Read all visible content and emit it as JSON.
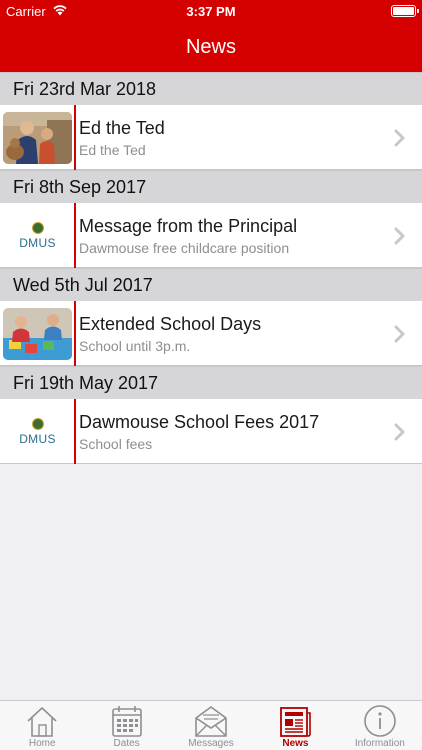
{
  "status_bar": {
    "carrier": "Carrier",
    "time": "3:37 PM"
  },
  "nav": {
    "title": "News"
  },
  "sections": [
    {
      "date": "Fri 23rd Mar 2018",
      "item": {
        "title": "Ed the Ted",
        "subtitle": "Ed the Ted",
        "thumbnail": "photo-children-teddy"
      }
    },
    {
      "date": "Fri 8th Sep 2017",
      "item": {
        "title": "Message from the Principal",
        "subtitle": "Dawmouse free childcare position",
        "thumbnail": "dmus-logo",
        "logo_text": "DMUS"
      }
    },
    {
      "date": "Wed 5th Jul 2017",
      "item": {
        "title": "Extended School Days",
        "subtitle": "School until 3p.m.",
        "thumbnail": "photo-children-playing"
      }
    },
    {
      "date": "Fri 19th May 2017",
      "item": {
        "title": "Dawmouse School Fees 2017",
        "subtitle": "School fees",
        "thumbnail": "dmus-logo",
        "logo_text": "DMUS"
      }
    }
  ],
  "tabs": [
    {
      "label": "Home",
      "icon": "home-icon",
      "active": false
    },
    {
      "label": "Dates",
      "icon": "calendar-icon",
      "active": false
    },
    {
      "label": "Messages",
      "icon": "envelope-icon",
      "active": false
    },
    {
      "label": "News",
      "icon": "newspaper-icon",
      "active": true
    },
    {
      "label": "Information",
      "icon": "info-icon",
      "active": false
    }
  ],
  "colors": {
    "brand_red": "#d50000",
    "active_tab": "#b00000",
    "section_bg": "#d6d6d9"
  }
}
